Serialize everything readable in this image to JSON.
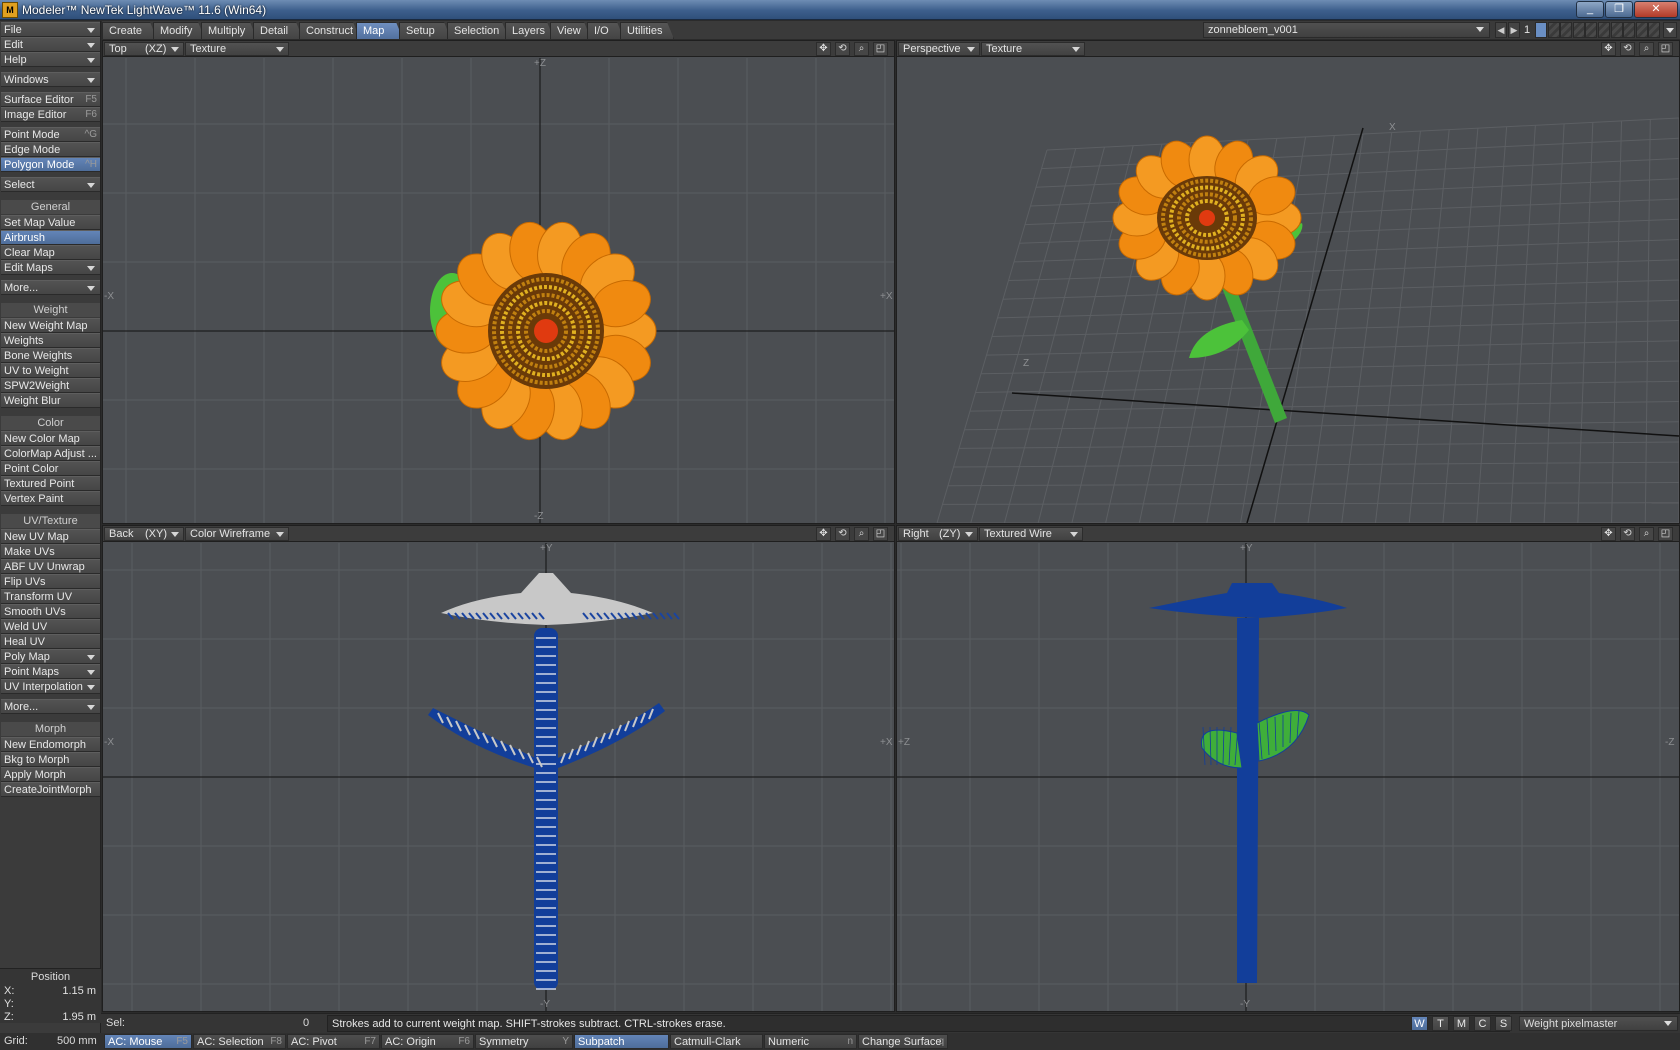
{
  "window": {
    "title": "Modeler™ NewTek LightWave™ 11.6 (Win64)",
    "controls": [
      "_",
      "❐",
      "✕"
    ]
  },
  "menu_tabs": [
    "Create",
    "Modify",
    "Multiply",
    "Detail",
    "Construct",
    "Map",
    "Setup",
    "Selection",
    "Layers",
    "View",
    "I/O",
    "Utilities"
  ],
  "active_tab": "Map",
  "scene": {
    "object_name": "zonnebloem_v001",
    "layer_number": "1"
  },
  "sidebar": {
    "top": [
      {
        "label": "File",
        "dropdown": true
      },
      {
        "label": "Edit",
        "dropdown": true
      },
      {
        "label": "Help",
        "dropdown": true
      }
    ],
    "windows": {
      "label": "Windows",
      "dropdown": true
    },
    "editors": [
      {
        "label": "Surface Editor",
        "key": "F5"
      },
      {
        "label": "Image Editor",
        "key": "F6"
      }
    ],
    "modes": [
      {
        "label": "Point Mode",
        "key": "^G"
      },
      {
        "label": "Edge Mode",
        "key": ""
      },
      {
        "label": "Polygon Mode",
        "key": "^H",
        "active": true
      }
    ],
    "select": {
      "label": "Select",
      "dropdown": true
    },
    "sections": [
      {
        "title": "General",
        "items": [
          {
            "label": "Set Map Value"
          },
          {
            "label": "Airbrush",
            "active": true
          },
          {
            "label": "Clear Map"
          },
          {
            "label": "Edit Maps",
            "dropdown": true
          },
          {
            "label": "More...",
            "dropdown": true
          }
        ]
      },
      {
        "title": "Weight",
        "items": [
          {
            "label": "New Weight Map"
          },
          {
            "label": "Weights"
          },
          {
            "label": "Bone Weights"
          },
          {
            "label": "UV to Weight"
          },
          {
            "label": "SPW2Weight"
          },
          {
            "label": "Weight Blur"
          }
        ]
      },
      {
        "title": "Color",
        "items": [
          {
            "label": "New Color Map"
          },
          {
            "label": "ColorMap Adjust ..."
          },
          {
            "label": "Point Color"
          },
          {
            "label": "Textured Point"
          },
          {
            "label": "Vertex Paint"
          }
        ]
      },
      {
        "title": "UV/Texture",
        "items": [
          {
            "label": "New UV Map"
          },
          {
            "label": "Make UVs"
          },
          {
            "label": "ABF UV Unwrap"
          },
          {
            "label": "Flip UVs"
          },
          {
            "label": "Transform UV"
          },
          {
            "label": "Smooth UVs"
          },
          {
            "label": "Weld UV"
          },
          {
            "label": "Heal UV"
          },
          {
            "label": "Poly Map",
            "dropdown": true
          },
          {
            "label": "Point Maps",
            "dropdown": true
          },
          {
            "label": "UV Interpolation",
            "dropdown": true
          },
          {
            "label": "More...",
            "dropdown": true
          }
        ]
      },
      {
        "title": "Morph",
        "items": [
          {
            "label": "New Endomorph"
          },
          {
            "label": "Bkg to Morph"
          },
          {
            "label": "Apply Morph"
          },
          {
            "label": "CreateJointMorph"
          }
        ]
      }
    ],
    "position": {
      "title": "Position",
      "x_label": "X:",
      "x_value": "1.15 m",
      "y_label": "Y:",
      "y_value": "",
      "z_label": "Z:",
      "z_value": "1.95 m"
    }
  },
  "viewports": [
    {
      "id": "top",
      "view": "Top",
      "axes": "(XZ)",
      "mode": "Texture",
      "axis_labels": {
        "top": "+Z",
        "bottom": "-Z",
        "left": "-X",
        "right": "+X"
      }
    },
    {
      "id": "persp",
      "view": "Perspective",
      "axes": "",
      "mode": "Texture",
      "axis_labels": {
        "x": "X",
        "z": "Z"
      }
    },
    {
      "id": "back",
      "view": "Back",
      "axes": "(XY)",
      "mode": "Color Wireframe",
      "axis_labels": {
        "top": "+Y",
        "bottom": "-Y",
        "left": "-X",
        "right": "+X"
      }
    },
    {
      "id": "right",
      "view": "Right",
      "axes": "(ZY)",
      "mode": "Textured Wire",
      "axis_labels": {
        "top": "+Y",
        "bottom": "-Y",
        "left": "+Z",
        "right": "-Z"
      }
    }
  ],
  "viewport_icons": {
    "move": "✥",
    "rotate": "⟲",
    "zoom": "⌕",
    "max": "◰"
  },
  "status": {
    "sel_label": "Sel:",
    "sel_value": "0",
    "message": "Strokes add to current weight map. SHIFT-strokes subtract. CTRL-strokes erase.",
    "wtmcs": [
      "W",
      "T",
      "M",
      "C",
      "S"
    ],
    "wtmcs_active": "W",
    "vmap": "Weight pixelmaster"
  },
  "bottom": {
    "grid_label": "Grid:",
    "grid_value": "500 mm",
    "buttons": [
      {
        "label": "AC: Mouse",
        "key": "F5",
        "active": true
      },
      {
        "label": "AC: Selection",
        "key": "F8"
      },
      {
        "label": "AC: Pivot",
        "key": "F7"
      },
      {
        "label": "AC: Origin",
        "key": "F6"
      },
      {
        "label": "Symmetry",
        "key": "Y"
      },
      {
        "label": "Subpatch",
        "key": "",
        "active": true
      },
      {
        "label": "Catmull-Clark",
        "key": ""
      },
      {
        "label": "Numeric",
        "key": "n"
      },
      {
        "label": "Change Surface",
        "key": "q"
      }
    ]
  },
  "colors": {
    "accent": "#5a7bab",
    "viewport_bg": "#4b4e52",
    "petal": "#f08a10",
    "leaf": "#4cc23a",
    "wire_blue": "#123e9a"
  }
}
